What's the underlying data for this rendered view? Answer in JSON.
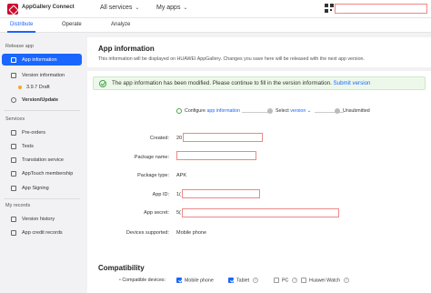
{
  "header": {
    "brand": "AppGallery Connect",
    "all_services": "All services",
    "my_apps": "My apps"
  },
  "tabs": [
    {
      "label": "Distribute",
      "active": true
    },
    {
      "label": "Operate"
    },
    {
      "label": "Analyze"
    }
  ],
  "sidebar": {
    "release_section": "Release app",
    "app_information": "App information",
    "version_information": "Version information",
    "version_draft": "3.9.7 Draft",
    "version_update": "Version/Update",
    "services_section": "Services",
    "preorders": "Pre-orders",
    "tests": "Tests",
    "translation": "Translation service",
    "apptouch": "AppTouch membership",
    "app_signing": "App Signing",
    "records_section": "My records",
    "version_history": "Version history",
    "app_credit": "App credit records"
  },
  "main": {
    "title": "App information",
    "description": "This information will be displayed on HUAWEI AppGallery. Changes you save here will be released with the next app version.",
    "notice": "The app information has been modified. Please continue to fill in the version information.",
    "notice_link": "Submit version",
    "steps": {
      "step1_prefix": "Configure",
      "step1_link": "app information",
      "step2_prefix": "Select",
      "step2_link": "version",
      "step3": "Unsubmitted"
    },
    "fields": {
      "created_label": "Created:",
      "created_value": "20",
      "package_name_label": "Package name:",
      "package_type_label": "Package type:",
      "package_type_value": "APK",
      "app_id_label": "App ID:",
      "app_id_value": "1(",
      "app_secret_label": "App secret:",
      "app_secret_value": "5(",
      "devices_label": "Devices supported:",
      "devices_value": "Mobile phone"
    },
    "compatibility": {
      "title": "Compatibility",
      "label": "Compatible devices:",
      "required_mark": "•",
      "devices": [
        {
          "label": "Mobile phone",
          "checked": true
        },
        {
          "label": "Tablet",
          "checked": true
        },
        {
          "label": "PC",
          "checked": false
        },
        {
          "label": "Huawei Watch",
          "checked": false
        }
      ]
    }
  },
  "colors": {
    "accent": "#1a66ff",
    "brand": "#cf0a2c",
    "success": "#41a84a"
  }
}
